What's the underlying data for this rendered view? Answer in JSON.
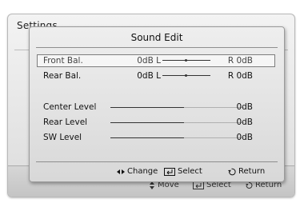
{
  "background_window": {
    "title": "Settings",
    "footer": {
      "move_label": "Move",
      "select_label": "Select",
      "return_label": "Return"
    }
  },
  "popup": {
    "title": "Sound Edit",
    "balance_rows": [
      {
        "label": "Front Bal.",
        "left_value": "0dB L",
        "right_value": "R 0dB",
        "position": 0.5,
        "focused": true
      },
      {
        "label": "Rear Bal.",
        "left_value": "0dB L",
        "right_value": "R 0dB",
        "position": 0.5,
        "focused": false
      }
    ],
    "level_rows": [
      {
        "label": "Center Level",
        "value": "0dB",
        "level": 0.55
      },
      {
        "label": "Rear Level",
        "value": "0dB",
        "level": 0.55
      },
      {
        "label": "SW Level",
        "value": "0dB",
        "level": 0.55
      }
    ],
    "footer": {
      "change_label": "Change",
      "select_label": "Select",
      "return_label": "Return"
    }
  },
  "colors": {
    "text": "#111111",
    "track": "#333333",
    "focus_border": "#7d7d7d"
  }
}
